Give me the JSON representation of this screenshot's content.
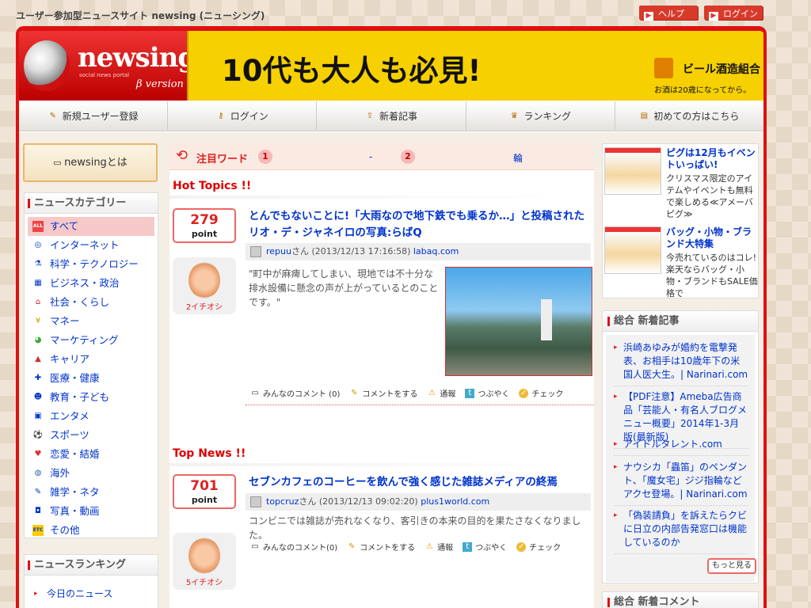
{
  "site_title": "ユーザー参加型ニュースサイト newsing (ニューシング)",
  "top_buttons": {
    "help": "ヘルプ",
    "login": "ログイン"
  },
  "logo": {
    "word": "newsing",
    "sub": "social news portal",
    "version": "β version"
  },
  "banner": {
    "headline": "10代も大人も必見!",
    "brand": "ビール酒造組合",
    "note": "お酒は20歳になってから。"
  },
  "gnav": [
    {
      "label": "新規ユーザー登録",
      "icon": "pencil-icon"
    },
    {
      "label": "ログイン",
      "icon": "key-icon"
    },
    {
      "label": "新着記事",
      "icon": "arrow-up-icon"
    },
    {
      "label": "ランキング",
      "icon": "crown-icon"
    },
    {
      "label": "初めての方はこちら",
      "icon": "book-icon"
    }
  ],
  "about": {
    "label": "newsingとは",
    "icon": "comment-icon"
  },
  "categories": {
    "title": "ニュースカテゴリー",
    "items": [
      {
        "label": "すべて",
        "icon": "all-icon"
      },
      {
        "label": "インターネット"
      },
      {
        "label": "科学・テクノロジー"
      },
      {
        "label": "ビジネス・政治"
      },
      {
        "label": "社会・くらし"
      },
      {
        "label": "マネー"
      },
      {
        "label": "マーケティング"
      },
      {
        "label": "キャリア"
      },
      {
        "label": "医療・健康"
      },
      {
        "label": "教育・子ども"
      },
      {
        "label": "エンタメ"
      },
      {
        "label": "スポーツ"
      },
      {
        "label": "恋愛・結婚"
      },
      {
        "label": "海外"
      },
      {
        "label": "雑学・ネタ"
      },
      {
        "label": "写真・動画"
      },
      {
        "label": "その他"
      }
    ]
  },
  "ranking": {
    "title": "ニュースランキング",
    "items": [
      "今日のニュース"
    ]
  },
  "hot_words": {
    "label": "注目ワード",
    "n1": "1",
    "w1": "-",
    "n2": "2",
    "w2": "輪"
  },
  "hot_topics": {
    "title": "Hot Topics !!",
    "item": {
      "points": "279",
      "point_label": "point",
      "title": "とんでもないことに!「大雨なので地下鉄でも乗るか…」と投稿されたリオ・デ・ジャネイロの写真:らばQ",
      "user": "repuu",
      "user_suffix": "さん",
      "date": "(2013/12/13 17:16:58)",
      "source": "labaq.com",
      "desc": "\"町中が麻痺してしまい、現地では不十分な排水設備に懸念の声が上がっているとのことです。\"",
      "ichioshi": "2イチオシ"
    }
  },
  "top_news": {
    "title": "Top News !!",
    "item": {
      "points": "701",
      "point_label": "point",
      "title": "セブンカフェのコーヒーを飲んで強く感じた雑誌メディアの終焉",
      "user": "topcruz",
      "user_suffix": "さん",
      "date": "(2013/12/13 09:02:20)",
      "source": "plus1world.com",
      "desc": "コンビニでは雑誌が売れなくなり、客引きの本来の目的を果たさなくなりました。",
      "ichioshi": "5イチオシ"
    }
  },
  "actions": {
    "comments1": "みんなのコメント (0)",
    "comments2": "みんなのコメント(0)",
    "comment": "コメントをする",
    "report": "通報",
    "tweet": "つぶやく",
    "check": "チェック"
  },
  "ads": [
    {
      "title": "ピグは12月もイベントいっぱい!",
      "text": "クリスマス限定のアイテムやイベントも無料で楽しめる≪アメーバピグ≫"
    },
    {
      "title": "バッグ・小物・ブランド大特集",
      "text": "今売れているのはコレ!楽天ならバッグ・小物・ブランドもSALE価格で"
    }
  ],
  "new_articles": {
    "title": "総合 新着記事",
    "items": [
      "浜崎あゆみが婚約を電撃発表、お相手は10歳年下の米国人医大生。| Narinari.com",
      "【PDF注意】Ameba広告商品「芸能人・有名人ブログメニュー概要」2014年1-3月版(最新版)",
      "アイドルタレント.com",
      "ナウシカ「蟲笛」のペンダント、「魔女宅」ジジ指輪などアクセ登場。| Narinari.com",
      "「偽装請負」を訴えたらクビに日立の内部告発窓口は機能しているのか"
    ],
    "more": "もっと見る"
  },
  "new_comments": {
    "title": "総合 新着コメント"
  }
}
